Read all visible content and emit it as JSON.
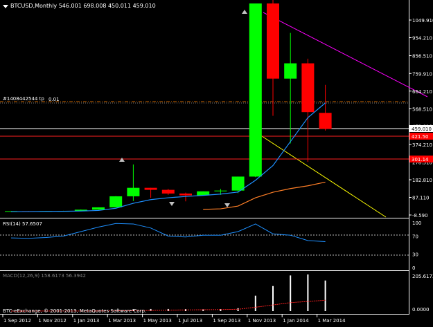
{
  "header": {
    "symbol_line": "BTCUSD,Monthly  546.001 698.008 450.011 459.010",
    "dropdown_icon": "triangle-down-icon"
  },
  "order_line_label": "#1408442544 tp",
  "order_line_suffix": "0.01",
  "indicators": {
    "rsi_label": "RSI(14) 57.6507",
    "macd_label": "MACD(12,26,9) 158.6173 56.3942"
  },
  "copyright": "BTC-eExchange, © 2001-2013, MetaQuotes Software Corp.",
  "colors": {
    "background": "#000000",
    "bull": "#00ff00",
    "bear": "#ff0000",
    "ma_blue": "#1e90ff",
    "ma_orange": "#ff7f27",
    "trend_magenta": "#ff00ff",
    "trend_yellow": "#ffff00",
    "hline_red": "#ff2020",
    "price_label_bg": "#ff0000"
  },
  "chart_data": {
    "type": "candlestick",
    "symbol": "BTCUSD",
    "timeframe": "Monthly",
    "price_axis_ticks": [
      1049.91,
      954.21,
      856.51,
      759.91,
      664.21,
      568.51,
      472.81,
      374.21,
      278.51,
      182.81,
      87.11,
      -8.59
    ],
    "current_price": 459.01,
    "red_level_labels": [
      "421.50",
      "301.14"
    ],
    "x_axis_labels": [
      "1 Sep 2012",
      "1 Nov 2012",
      "1 Jan 2013",
      "1 Mar 2013",
      "1 May 2013",
      "1 Jul 2013",
      "1 Sep 2013",
      "1 Nov 2013",
      "1 Jan 2014",
      "1 Mar 2014"
    ],
    "candles": [
      {
        "o": 10.0,
        "h": 12.5,
        "l": 9.8,
        "c": 12.3
      },
      {
        "o": 12.3,
        "h": 13.0,
        "l": 10.5,
        "c": 11.3
      },
      {
        "o": 11.3,
        "h": 13.0,
        "l": 10.3,
        "c": 12.8
      },
      {
        "o": 12.8,
        "h": 14.5,
        "l": 12.5,
        "c": 13.4
      },
      {
        "o": 13.4,
        "h": 21.5,
        "l": 13.2,
        "c": 20.3
      },
      {
        "o": 20.3,
        "h": 33.0,
        "l": 19.5,
        "c": 33.0
      },
      {
        "o": 33.0,
        "h": 94.0,
        "l": 32.5,
        "c": 93.0
      },
      {
        "o": 93.0,
        "h": 266.0,
        "l": 67.0,
        "c": 139.0
      },
      {
        "o": 139.0,
        "h": 139.5,
        "l": 85.0,
        "c": 128.0
      },
      {
        "o": 128.0,
        "h": 133.0,
        "l": 101.0,
        "c": 108.0
      },
      {
        "o": 108.0,
        "h": 113.0,
        "l": 65.5,
        "c": 98.0
      },
      {
        "o": 98.0,
        "h": 118.0,
        "l": 97.5,
        "c": 120.0
      },
      {
        "o": 120.0,
        "h": 133.0,
        "l": 101.0,
        "c": 124.0
      },
      {
        "o": 124.0,
        "h": 200.0,
        "l": 110.0,
        "c": 200.0
      },
      {
        "o": 200.0,
        "h": 1130.0,
        "l": 197.0,
        "c": 1140.0
      },
      {
        "o": 1140.0,
        "h": 1160.0,
        "l": 530.0,
        "c": 732.0
      },
      {
        "o": 732.0,
        "h": 980.0,
        "l": 380.0,
        "c": 815.0
      },
      {
        "o": 815.0,
        "h": 840.0,
        "l": 280.0,
        "c": 550.0
      },
      {
        "o": 546.001,
        "h": 698.008,
        "l": 450.011,
        "c": 459.01
      }
    ],
    "moving_average_blue": [
      9,
      10,
      11,
      11.5,
      13,
      16,
      28,
      55,
      75,
      85,
      92,
      98,
      105,
      116,
      180,
      260,
      390,
      520,
      600
    ],
    "moving_average_orange": [
      null,
      null,
      null,
      null,
      null,
      null,
      null,
      null,
      null,
      null,
      null,
      22,
      25,
      40,
      85,
      115,
      135,
      150,
      170
    ],
    "rsi": {
      "name": "RSI(14)",
      "value": 57.6507,
      "levels": [
        70,
        30
      ],
      "axis_ticks": [
        100,
        70,
        30,
        0
      ],
      "values": [
        66,
        65,
        67,
        70,
        80,
        90,
        98,
        97,
        88,
        70,
        68,
        72,
        72,
        80,
        97,
        75,
        72,
        60,
        57.65
      ]
    },
    "macd": {
      "name": "MACD(12,26,9)",
      "main": 158.6173,
      "signal": 56.3942,
      "axis_ticks": [
        "205.6173",
        "0.0000"
      ],
      "histogram": [
        0.3,
        0.3,
        0.4,
        0.4,
        1.0,
        1.5,
        5.0,
        10.0,
        11.0,
        11.0,
        10.0,
        10.0,
        10.0,
        15.0,
        80.0,
        130.0,
        185.0,
        190.0,
        158.6
      ],
      "signal_values": [
        0.2,
        0.2,
        0.3,
        0.3,
        0.4,
        0.7,
        1.4,
        2.5,
        3.5,
        5.0,
        6.0,
        7.0,
        8.0,
        9.5,
        20.0,
        32.0,
        44.0,
        50.0,
        56.4
      ]
    }
  }
}
